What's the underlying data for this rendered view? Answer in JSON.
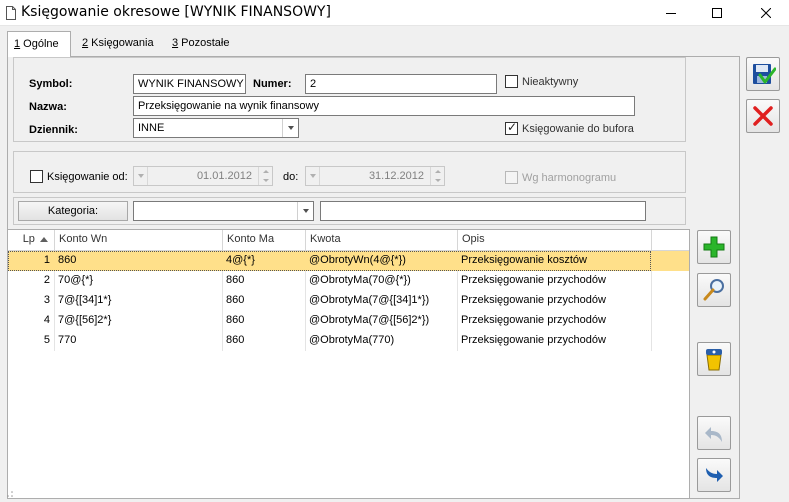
{
  "window": {
    "title": "Księgowanie okresowe [WYNIK FINANSOWY]"
  },
  "tabs": [
    {
      "key": "1",
      "label": " Ogólne"
    },
    {
      "key": "2",
      "label": " Księgowania"
    },
    {
      "key": "3",
      "label": " Pozostałe"
    }
  ],
  "form": {
    "symbol_label": "Symbol:",
    "symbol_value": "WYNIK FINANSOWY",
    "numer_label": "Numer:",
    "numer_value": "2",
    "nieaktywny_label": "Nieaktywny",
    "nieaktywny_checked": false,
    "nazwa_label": "Nazwa:",
    "nazwa_value": "Przeksięgowanie na wynik finansowy",
    "dziennik_label": "Dziennik:",
    "dziennik_value": "INNE",
    "bufor_label": "Księgowanie do bufora",
    "bufor_checked": true
  },
  "period": {
    "od_label": "Księgowanie od:",
    "od_checked": false,
    "od_value": "01.01.2012",
    "do_label": "do:",
    "do_value": "31.12.2012",
    "harmonogram_label": "Wg harmonogramu"
  },
  "category": {
    "button_label": "Kategoria:",
    "combo_value": "",
    "text_value": ""
  },
  "table": {
    "columns": [
      "Lp",
      "Konto Wn",
      "Konto Ma",
      "Kwota",
      "Opis"
    ],
    "rows": [
      {
        "lp": "1",
        "wn": "860",
        "ma": "4@{*}",
        "kwota": "@ObrotyWn(4@{*})",
        "opis": "Przeksięgowanie kosztów"
      },
      {
        "lp": "2",
        "wn": "70@{*}",
        "ma": "860",
        "kwota": "@ObrotyMa(70@{*})",
        "opis": "Przeksięgowanie przychodów"
      },
      {
        "lp": "3",
        "wn": "7@{[34]1*}",
        "ma": "860",
        "kwota": "@ObrotyMa(7@{[34]1*})",
        "opis": "Przeksięgowanie przychodów"
      },
      {
        "lp": "4",
        "wn": "7@{[56]2*}",
        "ma": "860",
        "kwota": "@ObrotyMa(7@{[56]2*})",
        "opis": "Przeksięgowanie przychodów"
      },
      {
        "lp": "5",
        "wn": "770",
        "ma": "860",
        "kwota": "@ObrotyMa(770)",
        "opis": "Przeksięgowanie przychodów"
      }
    ]
  },
  "colors": {
    "selected_row": "#ffe08a",
    "add_green": "#2bb52b",
    "cancel_red": "#e02020",
    "save_blue": "#1d4e9e"
  }
}
